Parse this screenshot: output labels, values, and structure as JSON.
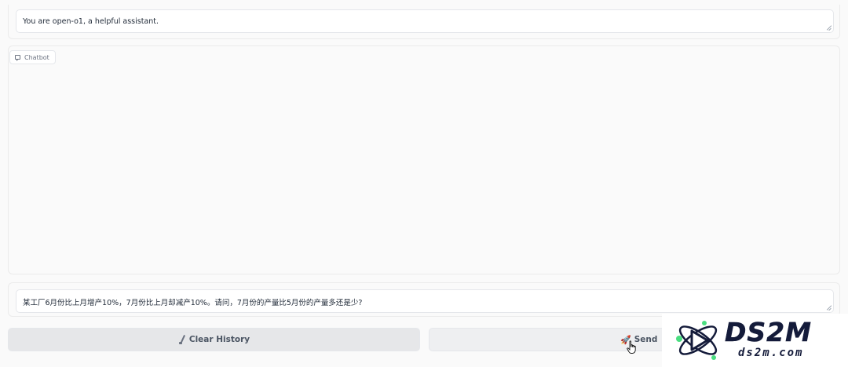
{
  "system_prompt": {
    "value": "You are open-o1, a helpful assistant."
  },
  "chatbot": {
    "label": "Chatbot",
    "icon": "chat-icon"
  },
  "question_input": {
    "value": "某工厂6月份比上月增产10%，7月份比上月却减产10%。请问，7月份的产量比5月份的产量多还是少?"
  },
  "buttons": {
    "clear_label": "Clear History",
    "clear_icon": "brush-icon",
    "send_label": "Send",
    "send_icon": "rocket-icon"
  },
  "watermark": {
    "logo_text": "DS2M",
    "url_text": "ds2m.com",
    "brand_color": "#141b3a",
    "accent_color": "#4ade80"
  }
}
